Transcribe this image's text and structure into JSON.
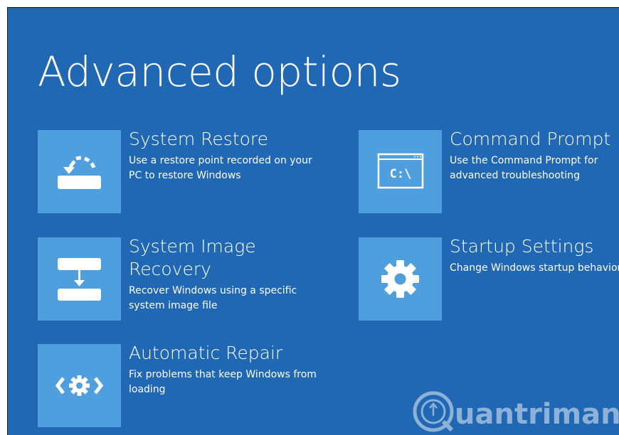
{
  "page": {
    "title": "Advanced options"
  },
  "options": [
    {
      "title": "System Restore",
      "description": "Use a restore point recorded on your PC to restore Windows",
      "icon": "restore-icon"
    },
    {
      "title": "Command Prompt",
      "description": "Use the Command Prompt for advanced troubleshooting",
      "icon": "command-prompt-icon",
      "icon_text": "C:\\"
    },
    {
      "title": "System Image Recovery",
      "description": "Recover Windows using a specific system image file",
      "icon": "image-recovery-icon"
    },
    {
      "title": "Startup Settings",
      "description": "Change Windows startup behavior",
      "icon": "gear-icon"
    },
    {
      "title": "Automatic Repair",
      "description": "Fix problems that keep Windows from loading",
      "icon": "repair-icon"
    }
  ],
  "watermark": {
    "text": "uantrimang"
  },
  "colors": {
    "background": "#2067b4",
    "tile": "#4f9fdf",
    "text": "#ffffff"
  }
}
